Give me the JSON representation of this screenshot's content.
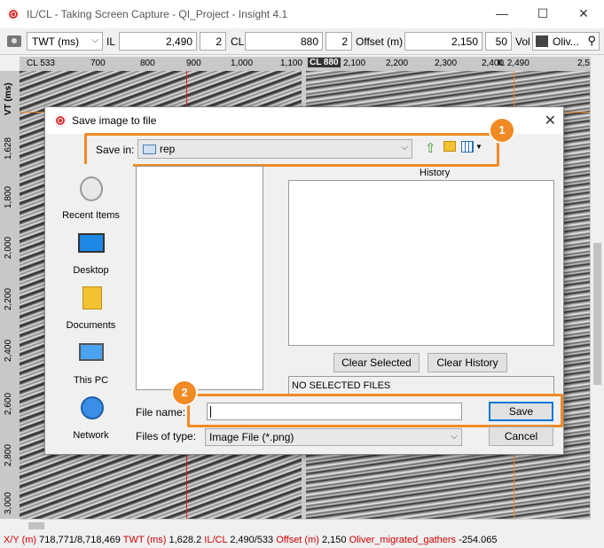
{
  "window": {
    "title": "IL/CL - Taking Screen Capture - QI_Project - Insight 4.1",
    "minimize": "—",
    "maximize": "☐",
    "close": "✕"
  },
  "toolbar": {
    "domain": "TWT (ms)",
    "il_label": "IL",
    "il_value": "2,490",
    "il_step": "2",
    "cl_label": "CL",
    "cl_value": "880",
    "cl_step": "2",
    "offset_label": "Offset (m)",
    "offset_value": "2,150",
    "offset_step": "50",
    "vol_label": "Vol",
    "vol_value": "Oliv..."
  },
  "rulers": {
    "left_panel_label": "CL 533",
    "left_ticks": [
      "700",
      "800",
      "900",
      "1,000",
      "1,100"
    ],
    "right_panel_label": "CL 880",
    "right_ticks": [
      "2,100",
      "2,200",
      "2,300",
      "2,400"
    ],
    "right_il_label": "IL 2,490",
    "right_last_tick": "2,5",
    "axis_title": "VT (ms)",
    "time_ticks": [
      "1,628",
      "1,800",
      "2,000",
      "2,200",
      "2,400",
      "2,600",
      "2,800",
      "3,000"
    ]
  },
  "dialog": {
    "title": "Save image to file",
    "save_in_label": "Save in:",
    "save_in_value": "rep",
    "places": [
      "Recent Items",
      "Desktop",
      "Documents",
      "This PC",
      "Network"
    ],
    "history_label": "History",
    "clear_selected": "Clear Selected",
    "clear_history": "Clear History",
    "no_selected": "NO SELECTED FILES",
    "file_name_label": "File name:",
    "file_name_value": "",
    "files_of_type_label": "Files of type:",
    "files_of_type_value": "Image File (*.png)",
    "save_button": "Save",
    "cancel_button": "Cancel"
  },
  "callouts": {
    "one": "1",
    "two": "2",
    "color": "#f08a24"
  },
  "status": {
    "xy_label": "X/Y (m)",
    "xy_value": "718,771/8,718,469",
    "twt_label": "TWT (ms)",
    "twt_value": "1,628.2",
    "ilcl_label": "IL/CL",
    "ilcl_value": "2,490/533",
    "offset_label": "Offset (m)",
    "offset_value": "2,150",
    "gather_label": "Oliver_migrated_gathers",
    "gather_value": "-254.065"
  }
}
